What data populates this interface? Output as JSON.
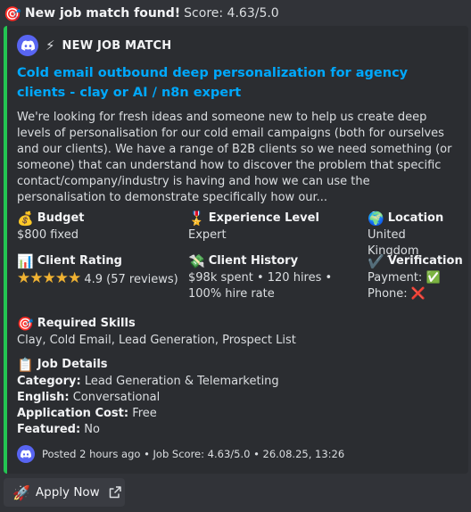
{
  "header": {
    "emoji": "🎯",
    "title": "New job match found!",
    "score_text": "Score: 4.63/5.0"
  },
  "embed": {
    "accent_color": "#23c552",
    "author": {
      "icon": "discord-logo-icon",
      "emoji": "⚡",
      "name": "NEW JOB MATCH"
    },
    "title": "Cold email outbound deep personalization for agency clients - clay or AI / n8n expert",
    "description": "We're looking for fresh ideas and someone new to help us create deep levels of personalisation for our cold email campaigns (both for ourselves and our clients). We have a range of B2B clients so we need something (or someone) that can understand how to discover the problem that specific contact/company/industry is having and how we can use the personalisation to demonstrate specifically how our...",
    "fields": {
      "budget": {
        "emoji": "💰",
        "name": "Budget",
        "value": "$800 fixed"
      },
      "experience": {
        "emoji": "🎖️",
        "name": "Experience Level",
        "value": "Expert"
      },
      "location": {
        "emoji": "🌍",
        "name": "Location",
        "value": "United Kingdom"
      },
      "client_rating": {
        "emoji": "📊",
        "name": "Client Rating",
        "stars": "★★★★★",
        "stars_count": 5,
        "value": "4.9 (57 reviews)"
      },
      "client_history": {
        "emoji": "💸",
        "name": "Client History",
        "value": "$98k spent • 120 hires • 100% hire rate"
      },
      "verification": {
        "emoji": "✔️",
        "name": "Verification",
        "payment_label": "Payment:",
        "payment_status": "✅",
        "phone_label": "Phone:",
        "phone_status": "❌"
      },
      "required_skills": {
        "emoji": "🎯",
        "name": "Required Skills",
        "value": "Clay, Cold Email, Lead Generation, Prospect List"
      },
      "job_details": {
        "emoji": "📋",
        "name": "Job Details",
        "category_label": "Category:",
        "category_value": "Lead Generation & Telemarketing",
        "english_label": "English:",
        "english_value": "Conversational",
        "application_cost_label": "Application Cost:",
        "application_cost_value": "Free",
        "featured_label": "Featured:",
        "featured_value": "No"
      }
    },
    "footer": {
      "icon": "discord-logo-icon",
      "text": "Posted 2 hours ago • Job Score: 4.63/5.0 • 26.08.25, 13:26"
    }
  },
  "button": {
    "emoji": "🚀",
    "label": "Apply Now",
    "icon": "external-link-icon"
  }
}
